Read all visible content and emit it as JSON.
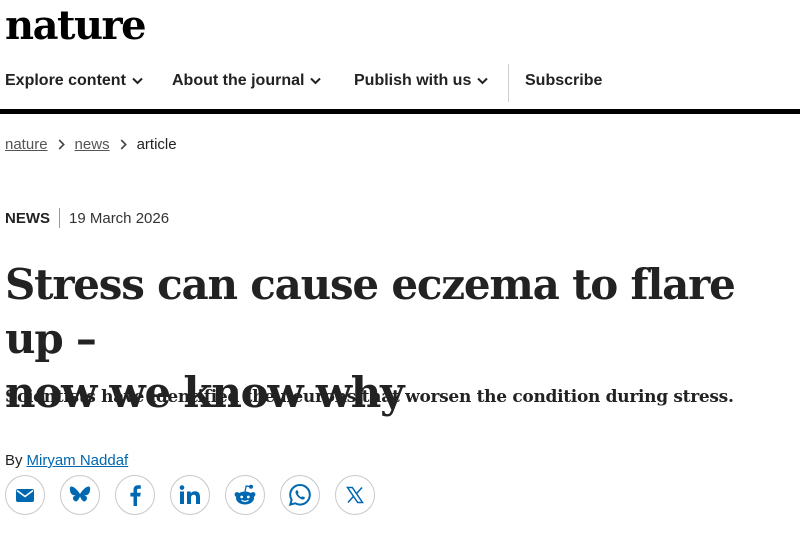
{
  "brand": {
    "logo_text": "nature"
  },
  "nav": {
    "items": [
      {
        "label": "Explore content"
      },
      {
        "label": "About the journal"
      },
      {
        "label": "Publish with us"
      }
    ],
    "subscribe_label": "Subscribe"
  },
  "breadcrumb": {
    "items": [
      "nature",
      "news",
      "article"
    ]
  },
  "article": {
    "type": "NEWS",
    "date": "19 March 2026",
    "title_line1": "Stress can cause eczema to flare up –",
    "title_line2": "now we know why",
    "standfirst": "Scientists have identified the neurons that worsen the condition during stress.",
    "byline_prefix": "By",
    "author": "Miryam Naddaf"
  },
  "share": {
    "icons": [
      "email-icon",
      "bluesky-icon",
      "facebook-icon",
      "linkedin-icon",
      "reddit-icon",
      "whatsapp-icon",
      "x-icon"
    ],
    "accent_color": "#0067b1"
  }
}
